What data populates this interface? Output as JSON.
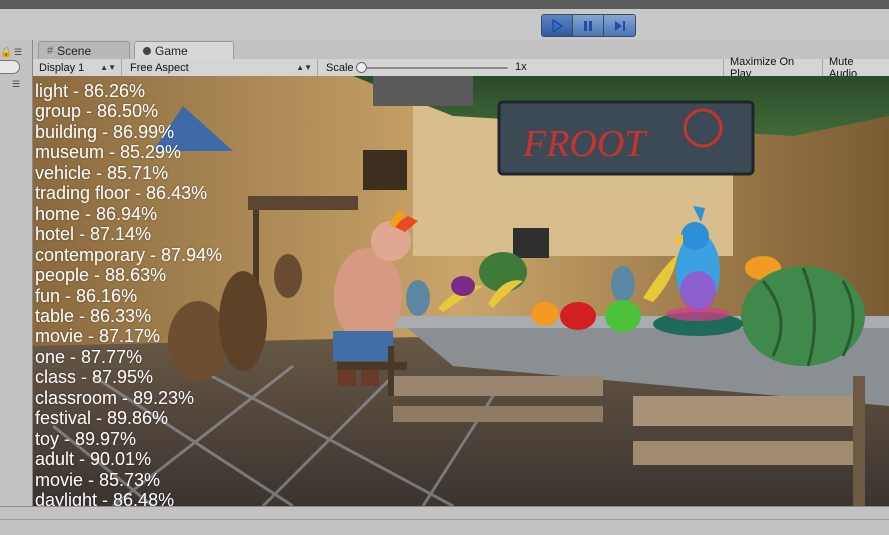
{
  "toolbar": {
    "play_icon": "play-icon",
    "pause_icon": "pause-icon",
    "step_icon": "step-icon",
    "accent": "#4b75b4"
  },
  "tabs": [
    {
      "label": "Scene",
      "icon": "grid-icon"
    },
    {
      "label": "Game",
      "icon": "game-controller-icon"
    }
  ],
  "game_toolbar": {
    "display": "Display 1",
    "aspect": "Free Aspect",
    "scale_label": "Scale",
    "scale_value": "1x",
    "maximize": "Maximize On Play",
    "mute": "Mute Audio"
  },
  "scene": {
    "sign_text": "FROOT"
  },
  "labels": [
    "light - 86.26%",
    "group - 86.50%",
    "building - 86.99%",
    "museum - 85.29%",
    "vehicle - 85.71%",
    "trading floor - 86.43%",
    "home - 86.94%",
    "hotel - 87.14%",
    "contemporary - 87.94%",
    "people - 88.63%",
    "fun - 86.16%",
    "table - 86.33%",
    "movie - 87.17%",
    "one - 87.77%",
    "class - 87.95%",
    "classroom - 89.23%",
    "festival - 89.86%",
    "toy - 89.97%",
    "adult - 90.01%",
    "movie - 85.73%",
    "daylight - 86.48%"
  ]
}
